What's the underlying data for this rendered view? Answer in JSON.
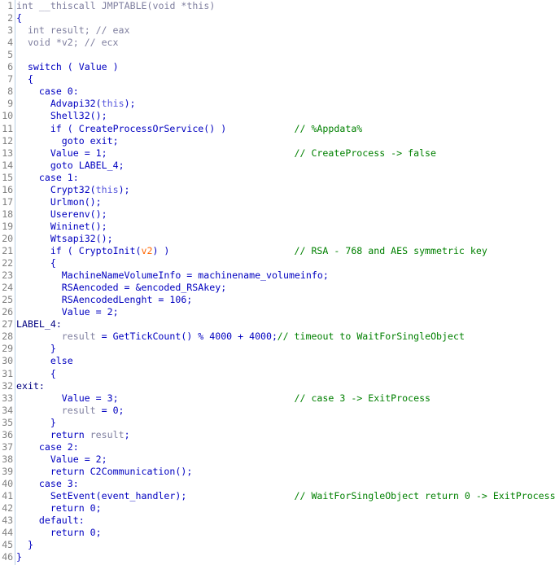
{
  "app": {
    "view": "hex-rays-pseudocode",
    "function_name": "JMPTABLE",
    "total_lines": 46
  },
  "gutter": {
    "numbers": [
      "1",
      "2",
      "3",
      "4",
      "5",
      "6",
      "7",
      "8",
      "9",
      "10",
      "11",
      "12",
      "13",
      "14",
      "15",
      "16",
      "17",
      "18",
      "19",
      "20",
      "21",
      "22",
      "23",
      "24",
      "25",
      "26",
      "27",
      "28",
      "29",
      "30",
      "31",
      "32",
      "33",
      "34",
      "35",
      "36",
      "37",
      "38",
      "39",
      "40",
      "41",
      "42",
      "43",
      "44",
      "45",
      "46"
    ]
  },
  "colors": {
    "background": "#ffffff",
    "line_number": "#808080",
    "gutter_rule": "#b9cfe4",
    "keyword": "#0000c0",
    "comment": "#008000",
    "register_var": "#ff6600",
    "pseudo_var": "#8080a0",
    "label": "#000080",
    "declaration": "#8080a0",
    "this_keyword": "#5555dd"
  },
  "code": [
    {
      "n": "1",
      "text": "int __thiscall JMPTABLE(void *this)",
      "indent": 0,
      "cls": "t-def",
      "comment": ""
    },
    {
      "n": "2",
      "text": "{",
      "indent": 0,
      "cls": "t-kw",
      "comment": ""
    },
    {
      "n": "3",
      "text": "int result; ",
      "indent": 1,
      "cls": "t-def",
      "comment": "// eax",
      "comment_cls": "t-gcmt",
      "inline": true
    },
    {
      "n": "4",
      "text": "void *v2; ",
      "indent": 1,
      "cls": "t-def",
      "comment": "// ecx",
      "comment_cls": "t-gcmt",
      "inline": true
    },
    {
      "n": "5",
      "text": "",
      "indent": 0,
      "cls": "t-kw",
      "comment": ""
    },
    {
      "n": "6",
      "text": "switch ( Value )",
      "indent": 1,
      "cls": "t-kw",
      "comment": ""
    },
    {
      "n": "7",
      "text": "{",
      "indent": 1,
      "cls": "t-kw",
      "comment": ""
    },
    {
      "n": "8",
      "text": "case 0:",
      "indent": 2,
      "cls": "t-kw",
      "comment": ""
    },
    {
      "n": "9",
      "text": "Advapi32(this);",
      "indent": 3,
      "cls": "t-kw",
      "comment": ""
    },
    {
      "n": "10",
      "text": "Shell32();",
      "indent": 3,
      "cls": "t-kw",
      "comment": ""
    },
    {
      "n": "11",
      "text": "if ( CreateProcessOrService() )",
      "indent": 3,
      "cls": "t-kw",
      "comment": "// %Appdata%"
    },
    {
      "n": "12",
      "text": "goto exit;",
      "indent": 4,
      "cls": "t-kw",
      "comment": ""
    },
    {
      "n": "13",
      "text": "Value = 1;",
      "indent": 3,
      "cls": "t-kw",
      "comment": "// CreateProcess -> false"
    },
    {
      "n": "14",
      "text": "goto LABEL_4;",
      "indent": 3,
      "cls": "t-kw",
      "comment": ""
    },
    {
      "n": "15",
      "text": "case 1:",
      "indent": 2,
      "cls": "t-kw",
      "comment": ""
    },
    {
      "n": "16",
      "text": "Crypt32(this);",
      "indent": 3,
      "cls": "t-kw",
      "comment": ""
    },
    {
      "n": "17",
      "text": "Urlmon();",
      "indent": 3,
      "cls": "t-kw",
      "comment": ""
    },
    {
      "n": "18",
      "text": "Userenv();",
      "indent": 3,
      "cls": "t-kw",
      "comment": ""
    },
    {
      "n": "19",
      "text": "Wininet();",
      "indent": 3,
      "cls": "t-kw",
      "comment": ""
    },
    {
      "n": "20",
      "text": "Wtsapi32();",
      "indent": 3,
      "cls": "t-kw",
      "comment": ""
    },
    {
      "n": "21",
      "text": "if ( CryptoInit(v2) )",
      "indent": 3,
      "cls": "t-kw",
      "comment": "// RSA - 768 and AES symmetric key"
    },
    {
      "n": "22",
      "text": "{",
      "indent": 3,
      "cls": "t-kw",
      "comment": ""
    },
    {
      "n": "23",
      "text": "MachineNameVolumeInfo = machinename_volumeinfo;",
      "indent": 4,
      "cls": "t-kw",
      "comment": ""
    },
    {
      "n": "24",
      "text": "RSAencoded = &encoded_RSAkey;",
      "indent": 4,
      "cls": "t-kw",
      "comment": ""
    },
    {
      "n": "25",
      "text": "RSAencodedLenght = 106;",
      "indent": 4,
      "cls": "t-kw",
      "comment": ""
    },
    {
      "n": "26",
      "text": "Value = 2;",
      "indent": 4,
      "cls": "t-kw",
      "comment": ""
    },
    {
      "n": "27",
      "text": "LABEL_4:",
      "indent": -1,
      "cls": "t-lbl",
      "comment": ""
    },
    {
      "n": "28",
      "text": "result = GetTickCount() % 4000 + 4000;",
      "indent": 4,
      "cls": "t-kw",
      "comment": "// timeout to WaitForSingleObject",
      "inline": true
    },
    {
      "n": "29",
      "text": "}",
      "indent": 3,
      "cls": "t-kw",
      "comment": ""
    },
    {
      "n": "30",
      "text": "else",
      "indent": 3,
      "cls": "t-kw",
      "comment": ""
    },
    {
      "n": "31",
      "text": "{",
      "indent": 3,
      "cls": "t-kw",
      "comment": ""
    },
    {
      "n": "32",
      "text": "exit:",
      "indent": -1,
      "cls": "t-lbl",
      "comment": ""
    },
    {
      "n": "33",
      "text": "Value = 3;",
      "indent": 4,
      "cls": "t-kw",
      "comment": "// case 3 -> ExitProcess"
    },
    {
      "n": "34",
      "text": "result = 0;",
      "indent": 4,
      "cls": "t-kw",
      "comment": ""
    },
    {
      "n": "35",
      "text": "}",
      "indent": 3,
      "cls": "t-kw",
      "comment": ""
    },
    {
      "n": "36",
      "text": "return result;",
      "indent": 3,
      "cls": "t-kw",
      "comment": ""
    },
    {
      "n": "37",
      "text": "case 2:",
      "indent": 2,
      "cls": "t-kw",
      "comment": ""
    },
    {
      "n": "38",
      "text": "Value = 2;",
      "indent": 3,
      "cls": "t-kw",
      "comment": ""
    },
    {
      "n": "39",
      "text": "return C2Communication();",
      "indent": 3,
      "cls": "t-kw",
      "comment": ""
    },
    {
      "n": "40",
      "text": "case 3:",
      "indent": 2,
      "cls": "t-kw",
      "comment": ""
    },
    {
      "n": "41",
      "text": "SetEvent(event_handler);",
      "indent": 3,
      "cls": "t-kw",
      "comment": "// WaitForSingleObject return 0 -> ExitProcess"
    },
    {
      "n": "42",
      "text": "return 0;",
      "indent": 3,
      "cls": "t-kw",
      "comment": ""
    },
    {
      "n": "43",
      "text": "default:",
      "indent": 2,
      "cls": "t-kw",
      "comment": ""
    },
    {
      "n": "44",
      "text": "return 0;",
      "indent": 3,
      "cls": "t-kw",
      "comment": ""
    },
    {
      "n": "45",
      "text": "}",
      "indent": 1,
      "cls": "t-kw",
      "comment": ""
    },
    {
      "n": "46",
      "text": "}",
      "indent": 0,
      "cls": "t-kw",
      "comment": ""
    }
  ]
}
